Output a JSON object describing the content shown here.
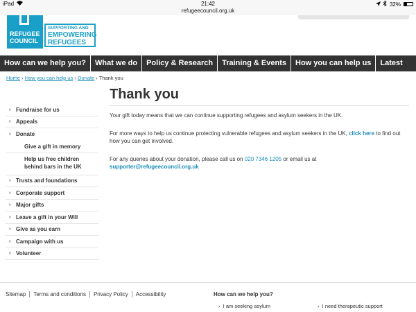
{
  "status_bar": {
    "carrier": "iPad",
    "time": "21:42",
    "battery": "32%",
    "battery_level": 0.32
  },
  "url": "refugeecouncil.org.uk",
  "logo": {
    "line1": "REFUGEE",
    "line2": "COUNCIL",
    "tag_line1": "SUPPORTING AND",
    "tag_line2": "EMPOWERING",
    "tag_line3": "REFUGEES"
  },
  "main_nav": [
    "How can we help you?",
    "What we do",
    "Policy & Research",
    "Training & Events",
    "How you can help us",
    "Latest"
  ],
  "breadcrumb": {
    "items": [
      "Home",
      "How you can help us",
      "Donate"
    ],
    "current": "Thank you",
    "separator": "›"
  },
  "sidebar": {
    "items_top": [
      "Fundraise for us",
      "Appeals",
      "Donate"
    ],
    "sub_items": [
      "Give a gift in memory",
      "Help us free children behind bars in the UK"
    ],
    "items_bottom": [
      "Trusts and foundations",
      "Corporate support",
      "Major gifts",
      "Leave a gift in your Will",
      "Give as you earn",
      "Campaign with us",
      "Volunteer"
    ]
  },
  "content": {
    "title": "Thank you",
    "para1": "Your gift today means that we can continue supporting refugees and asylum seekers in the UK.",
    "para2_before": "For more ways to help us continue protecting vulnerable refugees and asylum seekers in the UK, ",
    "para2_link": "click here",
    "para2_after": " to find out how you can get involved.",
    "para3_before": "For any queries about your donation, please call us on ",
    "phone": "020 7346 1205",
    "para3_after": " or email us at",
    "email": "supporter@refugeecouncil.org.uk"
  },
  "footer": {
    "links": [
      "Sitemap",
      "Terms and conditions",
      "Privacy Policy",
      "Accessibility"
    ],
    "help_heading": "How can we help you?",
    "options": [
      "I am seeking asylum",
      "I need therapeutic support"
    ]
  },
  "colors": {
    "brand": "#1aa0c8",
    "nav_bg": "#333333",
    "link": "#1a8cb8"
  }
}
